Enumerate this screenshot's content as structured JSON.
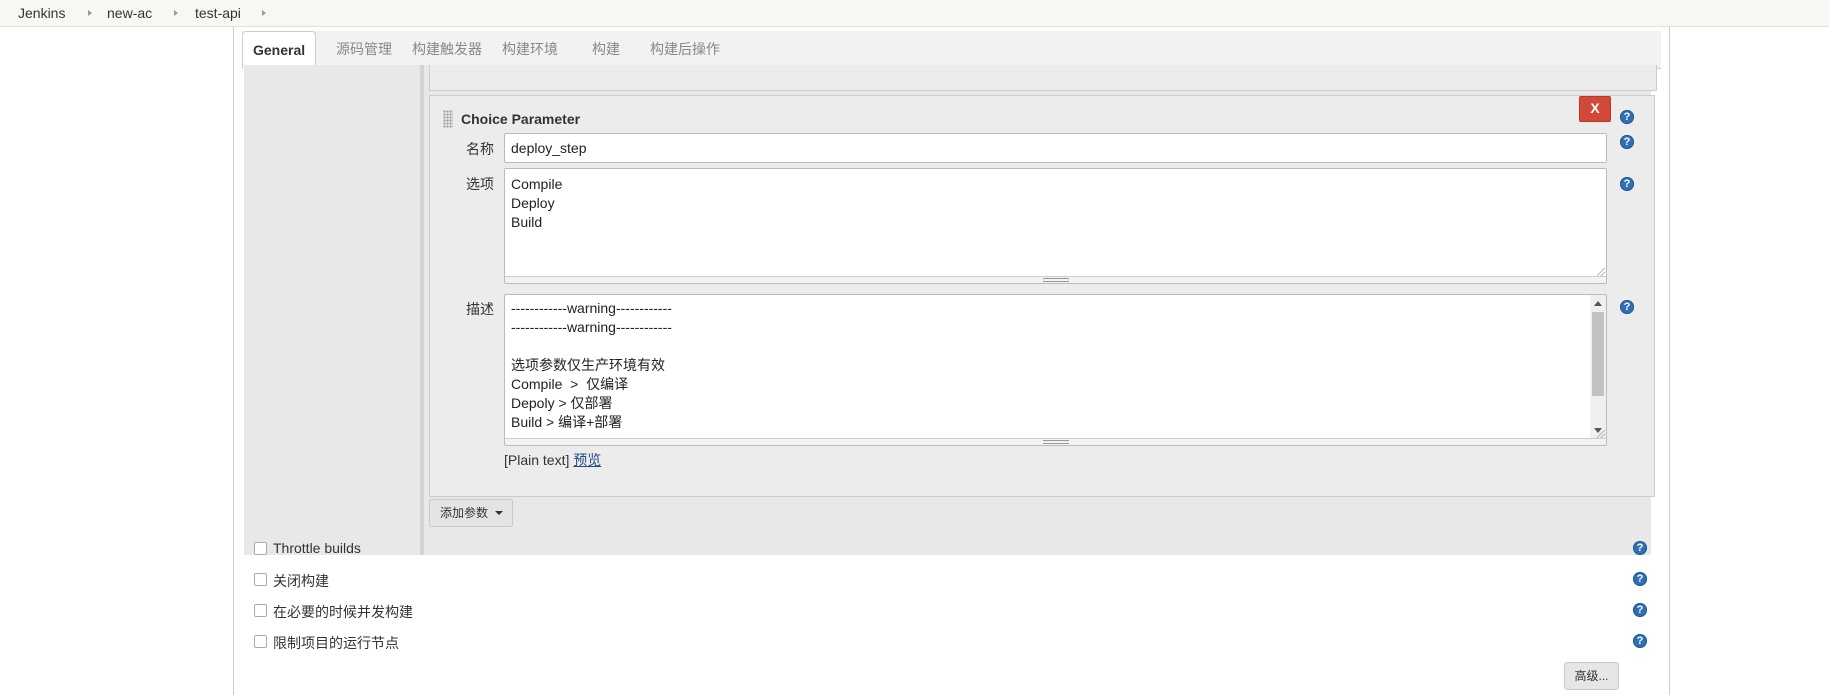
{
  "breadcrumb": {
    "items": [
      "Jenkins",
      "new-ac",
      "test-api"
    ]
  },
  "tabs": [
    {
      "label": "General",
      "active": true
    },
    {
      "label": "源码管理"
    },
    {
      "label": "构建触发器"
    },
    {
      "label": "构建环境"
    },
    {
      "label": "构建"
    },
    {
      "label": "构建后操作"
    }
  ],
  "parameter": {
    "title": "Choice Parameter",
    "delete_label": "X",
    "name_label": "名称",
    "name_value": "deploy_step",
    "choices_label": "选项",
    "choices": [
      "Compile",
      "Deploy",
      "Build"
    ],
    "description_label": "描述",
    "description_lines": [
      "------------warning------------",
      "------------warning------------",
      "",
      "选项参数仅生产环境有效",
      "Compile  >  仅编译",
      "Depoly > 仅部署",
      "Build > 编译+部署"
    ],
    "format_text": "[Plain text]",
    "preview_link": "预览"
  },
  "add_param_button": "添加参数",
  "options": [
    {
      "label": "Throttle builds",
      "checked": false
    },
    {
      "label": "关闭构建",
      "checked": false
    },
    {
      "label": "在必要的时候并发构建",
      "checked": false
    },
    {
      "label": "限制项目的运行节点",
      "checked": false
    }
  ],
  "advanced_button": "高级...",
  "help_icon_glyph": "?",
  "colors": {
    "delete": "#d24939",
    "help": "#2f6fb2",
    "link": "#204a87"
  }
}
